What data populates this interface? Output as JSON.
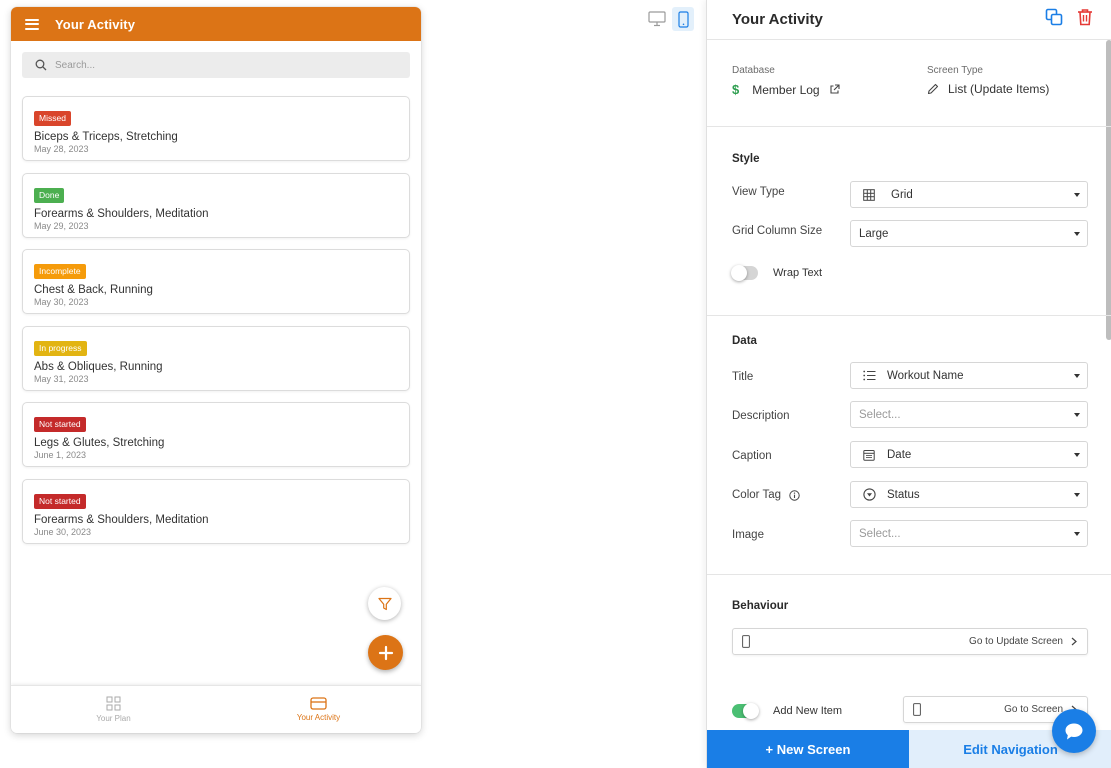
{
  "app": {
    "screen_title": "Your Activity",
    "search_placeholder": "Search..."
  },
  "cards": [
    {
      "status": "Missed",
      "status_color": "#d9452b",
      "title": "Biceps & Triceps, Stretching",
      "date": "May 28, 2023"
    },
    {
      "status": "Done",
      "status_color": "#4caf50",
      "title": "Forearms & Shoulders, Meditation",
      "date": "May 29, 2023"
    },
    {
      "status": "Incomplete",
      "status_color": "#f59b0b",
      "title": "Chest & Back, Running",
      "date": "May 30, 2023"
    },
    {
      "status": "In progress",
      "status_color": "#e2b412",
      "title": "Abs & Obliques, Running",
      "date": "May 31, 2023"
    },
    {
      "status": "Not started",
      "status_color": "#c42a2a",
      "title": "Legs & Glutes, Stretching",
      "date": "June 1, 2023"
    },
    {
      "status": "Not started",
      "status_color": "#c42a2a",
      "title": "Forearms & Shoulders, Meditation",
      "date": "June 30, 2023"
    }
  ],
  "bottom_nav": [
    {
      "label": "Your Plan",
      "icon": "grid-icon",
      "active": false
    },
    {
      "label": "Your Activity",
      "icon": "card-icon",
      "active": true
    }
  ],
  "panel": {
    "title": "Your Activity",
    "database_label": "Database",
    "database_value": "Member Log",
    "screen_type_label": "Screen Type",
    "screen_type_value": "List (Update Items)",
    "style": {
      "title": "Style",
      "view_type_label": "View Type",
      "view_type_value": "Grid",
      "grid_column_label": "Grid Column Size",
      "grid_column_value": "Large",
      "wrap_text_label": "Wrap Text",
      "wrap_text_on": false
    },
    "data": {
      "title": "Data",
      "title_label": "Title",
      "title_value": "Workout Name",
      "description_label": "Description",
      "description_value": "Select...",
      "caption_label": "Caption",
      "caption_value": "Date",
      "color_tag_label": "Color Tag",
      "color_tag_value": "Status",
      "image_label": "Image",
      "image_value": "Select..."
    },
    "behaviour": {
      "title": "Behaviour",
      "update_screen_link": "Go to Update Screen",
      "add_new_item_label": "Add New Item",
      "add_new_item_on": true,
      "go_to_screen_link": "Go to Screen"
    },
    "footer": {
      "new_screen": "+ New Screen",
      "edit_navigation": "Edit Navigation"
    }
  },
  "colors": {
    "brand_orange": "#dc7416",
    "accent_blue": "#1a7ee6",
    "delete_red": "#e53935",
    "money_green": "#2e9e4f"
  }
}
